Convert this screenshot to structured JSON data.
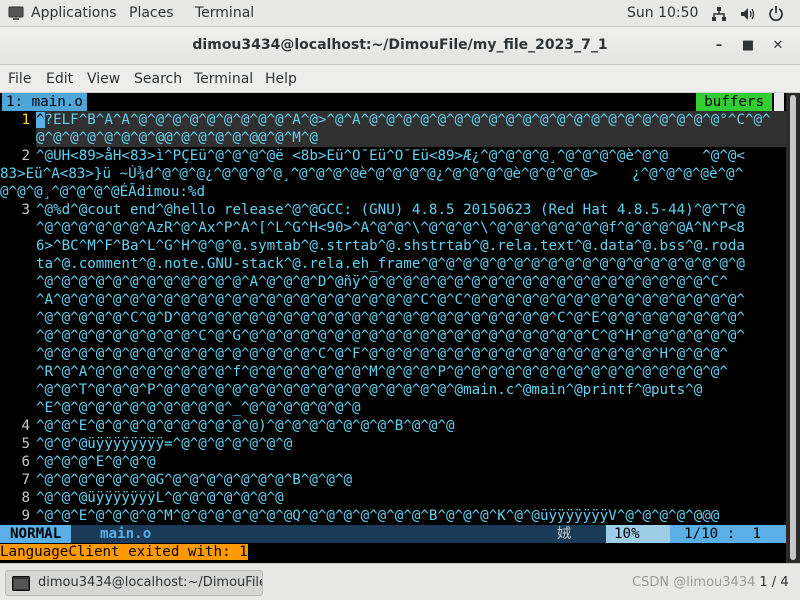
{
  "topbar": {
    "applications": "Applications",
    "places": "Places",
    "terminal": "Terminal",
    "clock": "Sun 10:50",
    "icons": [
      "network-icon",
      "volume-icon",
      "power-icon"
    ]
  },
  "window": {
    "title": "dimou3434@localhost:~/DimouFile/my_file_2023_7_1",
    "controls": [
      "minimize",
      "maximize",
      "close"
    ]
  },
  "menu": [
    "File",
    "Edit",
    "View",
    "Search",
    "Terminal",
    "Help"
  ],
  "vim": {
    "tab_label": "1: main.o",
    "buffers_label": "buffers",
    "lines": [
      {
        "num": "1",
        "text": "?ELF^B^A^A^@^@^@^@^@^@^@^@^@^A^@>^@^A^@^@^@^@^@^@^@^@^@^@^@^@^@^@^@^@^@^@^@^@^@°^C^@^",
        "cont": [
          "@^@^@^@^@^@^@^@@^@^@^@^@^@@^@^M^@"
        ]
      },
      {
        "num": "2",
        "text": "^@UH<89>åH<83>ì^PÇEü^@^@^@^@ë <8b>Eü^O¯Eü^O¯Eü<89>Æ¿^@^@^@^@¸^@^@^@^@è^@^@    ^@^@<",
        "cont": [
          "83>Eü^A<83>}ü ~Ú¾d^@^@^@¿^@^@^@^@¸^@^@^@^@è^@^@^@^@¿^@^@^@^@è^@^@^@^@>    ¿^@^@^@^@è^@^",
          "@^@^@¸^@^@^@^@ÉÃdimou:%d"
        ]
      },
      {
        "num": "3",
        "text": "^@%d^@cout end^@hello release^@^@GCC: (GNU) 4.8.5 20150623 (Red Hat 4.8.5-44)^@^T^@",
        "cont": [
          "^@^@^@^@^@^@^AzR^@^Ax^P^A^[^L^G^H<90>^A^@^@^\\^@^@^@^\\^@^@^@^@^@^@^@f^@^@^@^@A^N^P<8",
          "6>^BC^M^F^Ba^L^G^H^@^@^@.symtab^@.strtab^@.shstrtab^@.rela.text^@.data^@.bss^@.roda",
          "ta^@.comment^@.note.GNU-stack^@.rela.eh_frame^@^@^@^@^@^@^@^@^@^@^@^@^@^@^@^@^@^@^@",
          "^@^@^@^@^@^@^@^@^@^@^@^@^A^@^@^@^D^@ñÿ^@^@^@^@^@^@^@^@^@^@^@^@^@^@^@^@^@^@^@^@^C^",
          "^A^@^@^@^@^@^@^@^@^@^@^@^@^@^@^@^@^@^@^@^@^@^C^@^C^@^@^@^@^@^@^@^@^@^@^@^@^@^@^@^@^",
          "^@^@^@^@^@^C^@^D^@^@^@^@^@^@^@^@^@^@^@^@^@^@^@^@^@^@^@^@^@^@^C^@^E^@^@^@^@^@^@^@^@^",
          "^@^@^@^@^@^@^@^@^@^C^@^G^@^@^@^@^@^@^@^@^@^@^@^@^@^@^@^@^@^@^@^@^C^@^H^@^@^@^@^@^@^",
          "^@^@^@^@^@^@^@^@^@^@^@^@^@^@^@^@^C^@^F^@^@^@^@^@^@^@^@^@^@^@^@^@^@^@^@^@^H^@^@^@^",
          "^R^@^A^@^@^@^@^@^@^@^@^f^@^@^@^@^@^@^@^M^@^@^@^P^@^@^@^@^@^@^@^@^@^@^@^@^@^@^@^@^",
          "^@^@^T^@^@^@^P^@^@^@^@^@^@^@^@^@^@^@^@^@^@^@^@^@^@main.c^@main^@printf^@puts^@",
          "^E^@^@^@^@^@^@^@^@^@^@^_^@^@^@^@^@^@^@"
        ]
      },
      {
        "num": "4",
        "text": "^@^@^E^@^@^@^@^@^@^@^@^@^@)^@^@^@^@^@^@^@^B^@^@^@",
        "cont": []
      },
      {
        "num": "5",
        "text": "^@^@^@üÿÿÿÿÿÿÿÿ=^@^@^@^@^@^@^@",
        "cont": []
      },
      {
        "num": "6",
        "text": "^@^@^@^E^@^@^@",
        "cont": []
      },
      {
        "num": "7",
        "text": "^@^@^@^@^@^@^@G^@^@^@^@^@^@^@^B^@^@^@",
        "cont": []
      },
      {
        "num": "8",
        "text": "^@^@^@üÿÿÿÿÿÿÿL^@^@^@^@^@^@^@",
        "cont": []
      },
      {
        "num": "9",
        "text": "^@^@^E^@^@^@^@^M^@^@^@^@^@^@^@Q^@^@^@^@^@^@^@^B^@^@^@^K^@^@üÿÿÿÿÿÿÿV^@^@^@^@^@@@",
        "cont": []
      }
    ],
    "status": {
      "mode": "NORMAL",
      "filename": "main.o",
      "filetype": "娀",
      "percent": "10%",
      "position": "1/10 :  1"
    },
    "message": "LanguageClient exited with: 1"
  },
  "taskbar": {
    "task_label": "dimou3434@localhost:~/DimouFile/...",
    "watermark": "CSDN @limou3434",
    "workspace": "1 / 4"
  }
}
